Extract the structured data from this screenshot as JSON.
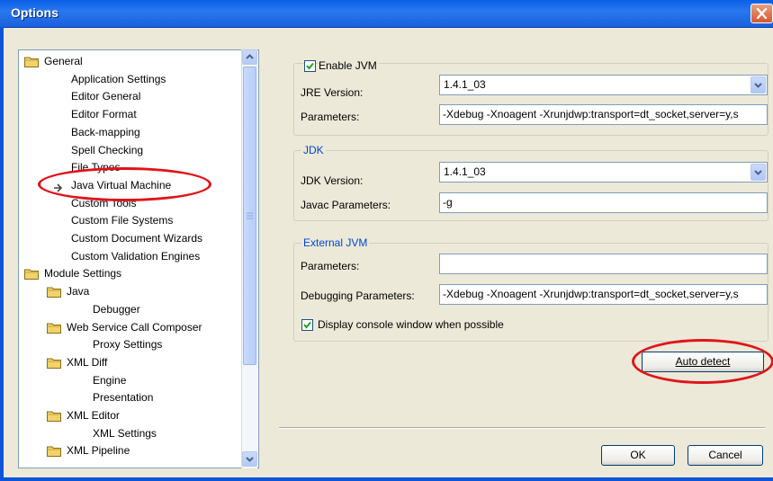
{
  "window": {
    "title": "Options"
  },
  "tree": {
    "items": [
      {
        "label": "General",
        "type": "folder",
        "level": 0
      },
      {
        "label": "Application Settings",
        "type": "leaf",
        "level": 1
      },
      {
        "label": "Editor General",
        "type": "leaf",
        "level": 1
      },
      {
        "label": "Editor Format",
        "type": "leaf",
        "level": 1
      },
      {
        "label": "Back-mapping",
        "type": "leaf",
        "level": 1
      },
      {
        "label": "Spell Checking",
        "type": "leaf",
        "level": 1
      },
      {
        "label": "File Types",
        "type": "leaf",
        "level": 1
      },
      {
        "label": "Java Virtual Machine",
        "type": "selected",
        "level": 1
      },
      {
        "label": "Custom Tools",
        "type": "leaf",
        "level": 1
      },
      {
        "label": "Custom File Systems",
        "type": "leaf",
        "level": 1
      },
      {
        "label": "Custom Document Wizards",
        "type": "leaf",
        "level": 1
      },
      {
        "label": "Custom Validation Engines",
        "type": "leaf",
        "level": 1
      },
      {
        "label": "Module Settings",
        "type": "folder",
        "level": 0
      },
      {
        "label": "Java",
        "type": "folder",
        "level": 1
      },
      {
        "label": "Debugger",
        "type": "leaf",
        "level": 2
      },
      {
        "label": "Web Service Call Composer",
        "type": "folder",
        "level": 1
      },
      {
        "label": "Proxy Settings",
        "type": "leaf",
        "level": 2
      },
      {
        "label": "XML Diff",
        "type": "folder",
        "level": 1
      },
      {
        "label": "Engine",
        "type": "leaf",
        "level": 2
      },
      {
        "label": "Presentation",
        "type": "leaf",
        "level": 2
      },
      {
        "label": "XML Editor",
        "type": "folder",
        "level": 1
      },
      {
        "label": "XML Settings",
        "type": "leaf",
        "level": 2
      },
      {
        "label": "XML Pipeline",
        "type": "folder",
        "level": 1
      }
    ]
  },
  "jvm": {
    "enable_label": "Enable JVM",
    "enable_checked": true,
    "jre_version_label": "JRE Version:",
    "jre_version_value": "1.4.1_03",
    "parameters_label": "Parameters:",
    "parameters_value": "-Xdebug -Xnoagent -Xrunjdwp:transport=dt_socket,server=y,s"
  },
  "jdk": {
    "legend": "JDK",
    "version_label": "JDK Version:",
    "version_value": "1.4.1_03",
    "javac_label": "Javac Parameters:",
    "javac_value": "-g"
  },
  "external_jvm": {
    "legend": "External JVM",
    "parameters_label": "Parameters:",
    "parameters_value": "",
    "debugging_label": "Debugging Parameters:",
    "debugging_value": "-Xdebug -Xnoagent -Xrunjdwp:transport=dt_socket,server=y,s",
    "console_label": "Display console window when possible",
    "console_checked": true
  },
  "buttons": {
    "auto_detect": "Auto detect",
    "ok": "OK",
    "cancel": "Cancel"
  },
  "colors": {
    "highlight_ring": "#e0141a",
    "title_bar": "#0a5fe8",
    "group_legend": "#0046d5"
  }
}
